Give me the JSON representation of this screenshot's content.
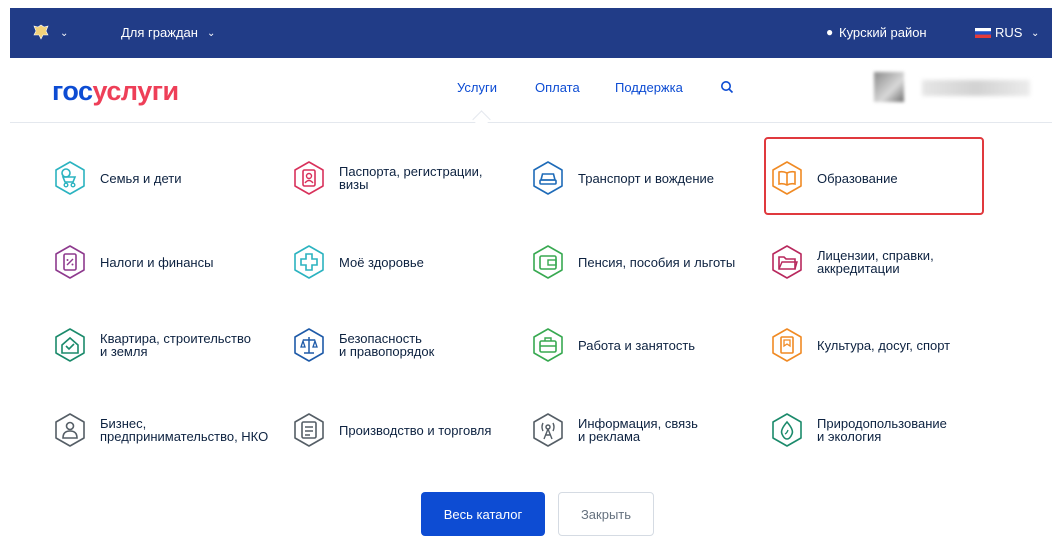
{
  "topbar": {
    "audience": "Для граждан",
    "region": "Курский район",
    "language": "RUS",
    "bg": "#213c87"
  },
  "header": {
    "logo_part1": "гос",
    "logo_part2": "услуги",
    "nav": {
      "services": "Услуги",
      "payment": "Оплата",
      "support": "Поддержка"
    },
    "search_icon": "search-icon"
  },
  "categories": [
    {
      "label": "Семья и дети",
      "icon": "stroller-icon",
      "color": "#2bb3c0"
    },
    {
      "label": "Паспорта, регистрации,\nвизы",
      "icon": "passport-icon",
      "color": "#d8315b"
    },
    {
      "label": "Транспорт и вождение",
      "icon": "car-icon",
      "color": "#1e6bb8"
    },
    {
      "label": "Образование",
      "icon": "book-icon",
      "color": "#f08a24"
    },
    {
      "label": "Налоги и финансы",
      "icon": "tax-document-icon",
      "color": "#8e3a8e"
    },
    {
      "label": "Моё здоровье",
      "icon": "medical-cross-icon",
      "color": "#2bb3c0"
    },
    {
      "label": "Пенсия, пособия и льготы",
      "icon": "wallet-icon",
      "color": "#38a951"
    },
    {
      "label": "Лицензии, справки,\nаккредитации",
      "icon": "folder-icon",
      "color": "#b8285d"
    },
    {
      "label": "Квартира, строительство\nи земля",
      "icon": "house-icon",
      "color": "#1b8a6b"
    },
    {
      "label": "Безопасность\nи правопорядок",
      "icon": "scales-icon",
      "color": "#1e5aa8"
    },
    {
      "label": "Работа и занятость",
      "icon": "briefcase-icon",
      "color": "#38a951"
    },
    {
      "label": "Культура, досуг, спорт",
      "icon": "bookmark-icon",
      "color": "#f08a24"
    },
    {
      "label": "Бизнес,\nпредпринимательство, НКО",
      "icon": "business-person-icon",
      "color": "#555e66"
    },
    {
      "label": "Производство и торговля",
      "icon": "production-icon",
      "color": "#555e66"
    },
    {
      "label": "Информация, связь\nи реклама",
      "icon": "antenna-icon",
      "color": "#555e66"
    },
    {
      "label": "Природопользование\nи экология",
      "icon": "leaf-drop-icon",
      "color": "#1b8a6b"
    }
  ],
  "buttons": {
    "catalog": "Весь каталог",
    "close": "Закрыть"
  }
}
